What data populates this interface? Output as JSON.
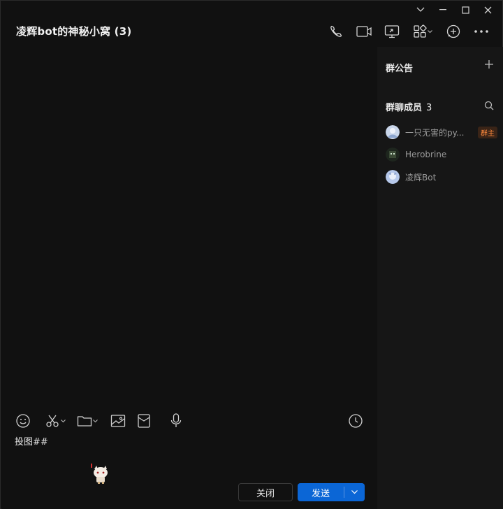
{
  "window": {
    "title": "凌辉bot的神秘小窝 (3)"
  },
  "header_tools": [
    {
      "name": "phone-icon"
    },
    {
      "name": "video-icon"
    },
    {
      "name": "screen-share-icon"
    },
    {
      "name": "apps-icon"
    },
    {
      "name": "add-icon"
    },
    {
      "name": "more-icon"
    }
  ],
  "side": {
    "notice_label": "群公告",
    "members_label": "群聊成员",
    "members_count": "3",
    "members": [
      {
        "name": "一只无害的py...",
        "badge": "群主",
        "avatar_color": "#c9d6ea"
      },
      {
        "name": "Herobrine",
        "badge": "",
        "avatar_color": "#2e3a2e"
      },
      {
        "name": "凌辉Bot",
        "badge": "",
        "avatar_color": "#b6c8ea"
      }
    ]
  },
  "input": {
    "text": "投图##"
  },
  "buttons": {
    "close_label": "关闭",
    "send_label": "发送"
  },
  "colors": {
    "accent": "#0b66d6",
    "owner_badge": "#ff8a3d",
    "background": "#111111",
    "panel": "#161616"
  }
}
